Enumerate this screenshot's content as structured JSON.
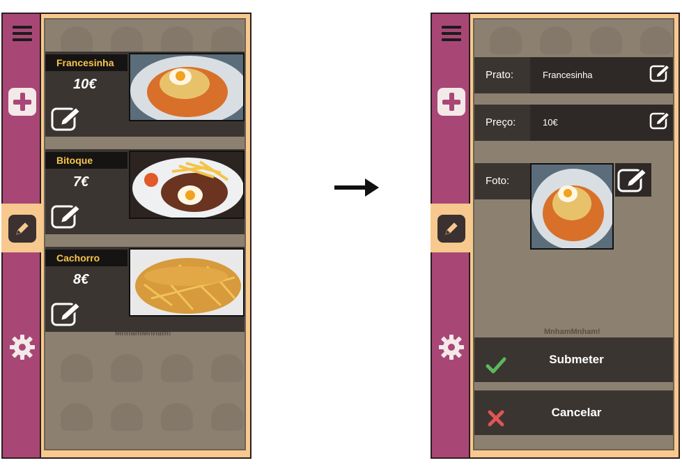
{
  "left_screen": {
    "sidebar": {
      "menu_icon": "hamburger-menu-icon",
      "add_icon": "plus-icon",
      "edit_icon": "pencil-icon",
      "settings_icon": "gear-icon"
    },
    "dishes": [
      {
        "name": "Francesinha",
        "price": "10€"
      },
      {
        "name": "Bitoque",
        "price": "7€"
      },
      {
        "name": "Cachorro",
        "price": "8€"
      }
    ],
    "watermark": "MnhamMnham!"
  },
  "right_screen": {
    "form": {
      "prato_label": "Prato:",
      "prato_value": "Francesinha",
      "preco_label": "Preço:",
      "preco_value": "10€",
      "foto_label": "Foto:"
    },
    "submit_label": "Submeter",
    "cancel_label": "Cancelar",
    "watermark": "MnhamMnham!"
  },
  "colors": {
    "sidebar": "#a84775",
    "accent_gold": "#f6c64b",
    "panel": "#3b3532",
    "check": "#5cb85c",
    "cross": "#e05555"
  }
}
